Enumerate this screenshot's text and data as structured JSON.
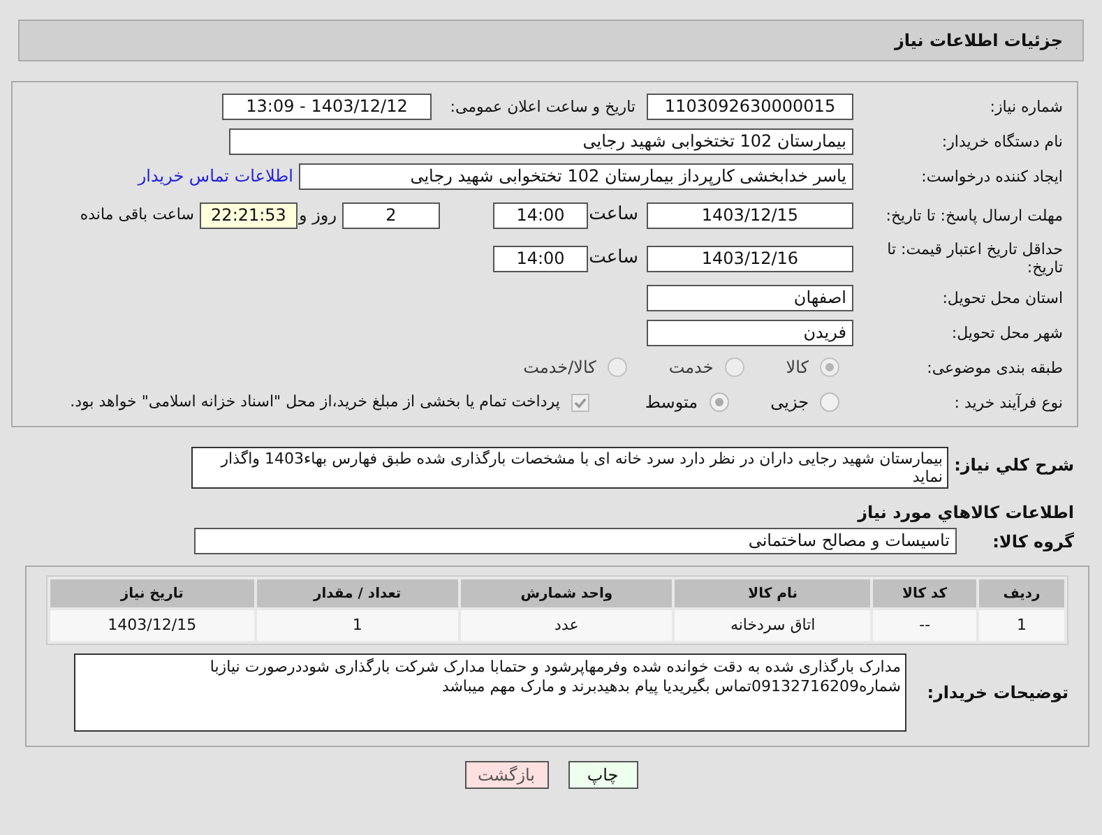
{
  "header": {
    "title": "جزئیات اطلاعات نیاز"
  },
  "details": {
    "need_number": {
      "label": "شماره نیاز:",
      "value": "1103092630000015"
    },
    "announce_date": {
      "label": "تاریخ و ساعت اعلان عمومی:",
      "value": "1403/12/12 - 13:09"
    },
    "buyer_org": {
      "label": "نام دستگاه خریدار:",
      "value": "بیمارستان 102 تختخوابی شهید رجایی"
    },
    "requester": {
      "label": "ایجاد کننده درخواست:",
      "value": "یاسر خدابخشی کارپرداز بیمارستان 102 تختخوابی شهید رجایی",
      "link": "اطلاعات تماس خریدار"
    },
    "response_deadline": {
      "label": "مهلت ارسال پاسخ: تا تاریخ:",
      "date": "1403/12/15",
      "time_label": "ساعت",
      "time": "14:00",
      "days": "2",
      "days_label": "روز و",
      "remaining": "22:21:53",
      "remaining_label": "ساعت باقی مانده"
    },
    "price_validity": {
      "label": "حداقل تاریخ اعتبار قیمت: تا تاریخ:",
      "date": "1403/12/16",
      "time_label": "ساعت",
      "time": "14:00"
    },
    "province": {
      "label": "استان محل تحویل:",
      "value": "اصفهان"
    },
    "city": {
      "label": "شهر محل تحویل:",
      "value": "فریدن"
    },
    "category": {
      "label": "طبقه بندی موضوعی:",
      "options": [
        {
          "label": "کالا",
          "selected": true
        },
        {
          "label": "خدمت",
          "selected": false
        },
        {
          "label": "کالا/خدمت",
          "selected": false
        }
      ]
    },
    "purchase_type": {
      "label": "نوع فرآیند خرید :",
      "options": [
        {
          "label": "جزیی",
          "selected": false
        },
        {
          "label": "متوسط",
          "selected": true
        }
      ],
      "treasury": {
        "label": "پرداخت تمام یا بخشی از مبلغ خرید،از محل \"اسناد خزانه اسلامی\" خواهد بود.",
        "checked": true
      }
    }
  },
  "summary": {
    "label": "شرح کلي نياز:",
    "value": "بیمارستان شهید رجایی داران در نظر دارد سرد خانه ای با مشخصات بارگذاری شده طبق فهارس بهاء1403 واگذار نماید"
  },
  "goods_title": "اطلاعات کالاهاي مورد نياز",
  "goods_group": {
    "label": "گروه کالا:",
    "value": "تاسیسات و مصالح ساختمانی"
  },
  "table": {
    "columns": [
      "ردیف",
      "کد کالا",
      "نام کالا",
      "واحد شمارش",
      "تعداد / مقدار",
      "تاریخ نیاز"
    ],
    "rows": [
      [
        "1",
        "--",
        "اتاق سردخانه",
        "عدد",
        "1",
        "1403/12/15"
      ]
    ]
  },
  "buyer_notes": {
    "label": "توضیحات خریدار:",
    "value": "مدارک بارگذاری شده به دقت خوانده شده وفرمهاپرشود و حتمابا مدارک شرکت بارگذاری شوددرصورت نیازبا شماره09132716209تماس بگیریدیا پیام بدهیدبرند و مارک مهم میباشد"
  },
  "buttons": [
    {
      "label": "چاپ",
      "kind": "print"
    },
    {
      "label": "بازگشت",
      "kind": "back"
    }
  ]
}
